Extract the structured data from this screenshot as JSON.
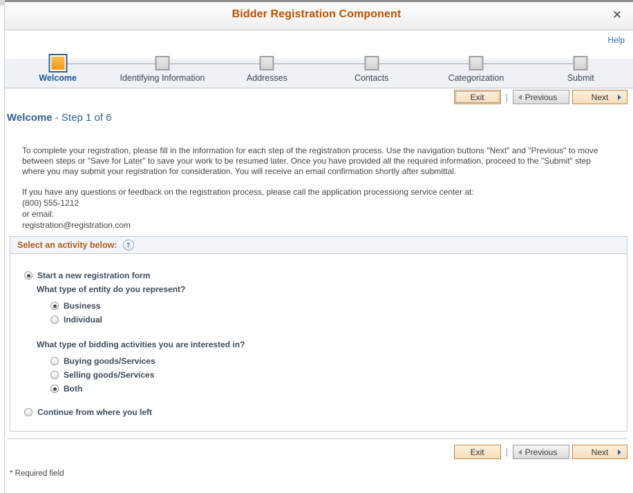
{
  "window": {
    "title": "Bidder Registration Component",
    "close_label": "✕"
  },
  "header": {
    "help_label": "Help"
  },
  "steps": [
    {
      "label": "Welcome",
      "state": "active"
    },
    {
      "label": "Identifying Information",
      "state": "inactive"
    },
    {
      "label": "Addresses",
      "state": "inactive"
    },
    {
      "label": "Contacts",
      "state": "inactive"
    },
    {
      "label": "Categorization",
      "state": "inactive"
    },
    {
      "label": "Submit",
      "state": "inactive"
    }
  ],
  "toolbar": {
    "exit_label": "Exit",
    "separator": "|",
    "previous_label": "Previous",
    "next_label": "Next"
  },
  "page": {
    "heading_title": "Welcome",
    "heading_step": " - Step 1 of 6",
    "paragraph_1": "To complete your registration, please fill in the information for each step of the registration process.  Use the navigation buttons \"Next\" and \"Previous\" to move between steps or \"Save for Later\" to save your work to be resumed later.  Once you have provided all the required information, proceed to the \"Submit\" step where you may submit your registration for consideration.  You will receive an email confirmation shortly after submittal.",
    "contact_line_1": "If you have any questions or feedback on the registration process, please call the application processiong service center at:",
    "contact_phone": "(800) 555-1212",
    "contact_email_label": "or email:",
    "contact_email": "registration@registration.com",
    "required_note": "* Required field"
  },
  "activity_panel": {
    "title": "Select an activity below:",
    "help_icon_glyph": "?",
    "options": {
      "start_new": {
        "label": "Start a new registration form",
        "checked": true
      },
      "continue": {
        "label": "Continue from where you left",
        "checked": false
      }
    },
    "entity_question": "What type of entity do you represent?",
    "entity_options": [
      {
        "label": "Business",
        "checked": true
      },
      {
        "label": "Individual",
        "checked": false
      }
    ],
    "bidding_question": "What type of bidding activities you are interested in?",
    "bidding_options": [
      {
        "label": "Buying goods/Services",
        "checked": false
      },
      {
        "label": "Selling goods/Services",
        "checked": false
      },
      {
        "label": "Both",
        "checked": true
      }
    ]
  },
  "colors": {
    "accent_orange": "#b75000",
    "panel_title": "#b05a16",
    "link_blue": "#2b6cb5",
    "heading_blue": "#2d5f9e",
    "active_step": "#f29a12"
  }
}
